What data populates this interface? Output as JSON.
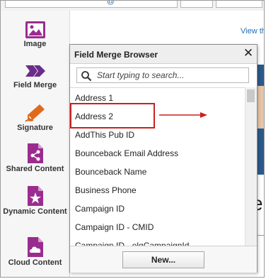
{
  "top_bar": {
    "fragment_symbol": "@"
  },
  "canvas": {
    "view_link": "View th",
    "text_fragment": "eb"
  },
  "palette": {
    "tools": [
      {
        "label": "Image",
        "icon": "image-icon"
      },
      {
        "label": "Field Merge",
        "icon": "field-merge-icon"
      },
      {
        "label": "Signature",
        "icon": "signature-pen-icon"
      },
      {
        "label": "Shared Content",
        "icon": "shared-content-icon"
      },
      {
        "label": "Dynamic Content",
        "icon": "dynamic-content-icon"
      },
      {
        "label": "Cloud Content",
        "icon": "cloud-content-icon"
      }
    ]
  },
  "dialog": {
    "title": "Field Merge Browser",
    "close": "✕",
    "search_placeholder": "Start typing to search...",
    "items": [
      "Address 1",
      "Address 2",
      "AddThis Pub ID",
      "Bounceback Email Address",
      "Bounceback Name",
      "Business Phone",
      "Campaign ID",
      "Campaign ID - CMID",
      "Campaign ID - elqCampaignId"
    ],
    "highlighted_item": "Address 2",
    "new_button": "New..."
  },
  "colors": {
    "accent_purple": "#9b2c8f",
    "field_merge_purple": "#6b2d8a",
    "signature_orange": "#e06a1c",
    "annotation_red": "#cc1f1f",
    "link_blue": "#1f6fb7"
  }
}
